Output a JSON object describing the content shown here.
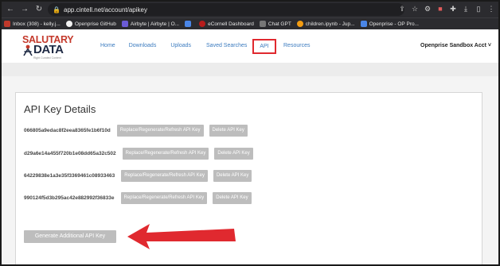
{
  "browser": {
    "url": "app.cintell.net/account/apikey",
    "bookmarks": [
      {
        "label": "Inbox (308) - kelly.j...",
        "color": "#c0392b"
      },
      {
        "label": "Openprise GitHub",
        "color": "#f1f1f1"
      },
      {
        "label": "Airbyte | Airbyte | O...",
        "color": "#6b5bd6"
      },
      {
        "label": "",
        "color": "#4a86e8"
      },
      {
        "label": "eCornell Dashboard",
        "color": "#b71c1c"
      },
      {
        "label": "Chat GPT",
        "color": "#777777"
      },
      {
        "label": "children.ipynb - Jup...",
        "color": "#f39c12"
      },
      {
        "label": "Openprise - OP Pro...",
        "color": "#4a86e8"
      }
    ]
  },
  "logo": {
    "line1": "SALUTARY",
    "line2": "DATA",
    "tagline": "Right Curated Content"
  },
  "nav": {
    "items": [
      "Home",
      "Downloads",
      "Uploads",
      "Saved Searches",
      "API",
      "Resources"
    ],
    "account": "Openprise Sandbox Acct ˅"
  },
  "page": {
    "title": "API Key Details",
    "keys": [
      "066805a9edac8f2eea8365fe1b6f10d",
      "d29a6e14a455f720b1e08dd65a32c502",
      "64229838e1a3e35f3369461c08933463",
      "990124f5d3b295ac42e882992f36833e"
    ],
    "replace_label": "Replace/Regenerate/Refresh API Key",
    "delete_label": "Delete API Key",
    "generate_label": "Generate Additional API Key"
  },
  "colors": {
    "accent_red": "#e0292f",
    "nav_link": "#3b7bbf",
    "button_grey": "#bdbdbd"
  }
}
